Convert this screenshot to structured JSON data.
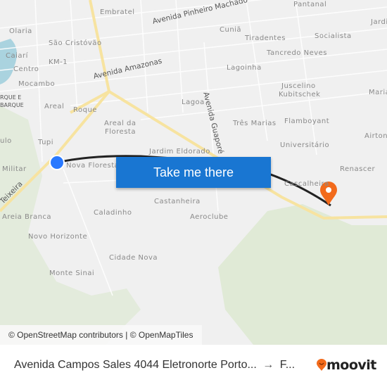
{
  "map": {
    "neighborhoods": [
      "Embratel",
      "Pantanal",
      "Olaria",
      "São Cristóvão",
      "Cuniã",
      "Tiradentes",
      "Socialista",
      "Jardi",
      "Caiarí",
      "KM-1",
      "Tancredo Neves",
      "Centro",
      "Lagoinha",
      "Mocambo",
      "Juscelino",
      "Kubitschek",
      "Maria",
      "RQUE E",
      "BARQUE",
      "Areal",
      "Roque",
      "Lagoa",
      "Areal da",
      "Floresta",
      "Três Marias",
      "Flamboyant",
      "Tupi",
      "Airton",
      "ulo",
      "Universitário",
      "Jardim Eldorado",
      "Militar",
      "Nova Floresta",
      "Cascalheira",
      "Renascer",
      "Castanheira",
      "Areia Branca",
      "Caladinho",
      "Aeroclube",
      "Novo Horizonte",
      "Cidade Nova",
      "Monte Sinai"
    ],
    "streets": [
      "Avenida Pinheiro Machado",
      "Avenida Amazonas",
      "Avenida Guaporé",
      "Teixeira"
    ],
    "origin_color": "#2979ff",
    "destination_color": "#f26a1b",
    "route_color": "#222222"
  },
  "cta": {
    "label": "Take me there",
    "color": "#1976d2"
  },
  "attribution": "© OpenStreetMap contributors | © OpenMapTiles",
  "footer": {
    "origin": "Avenida Campos Sales 4044 Eletronorte Porto...",
    "arrow": "→",
    "destination": "F...",
    "brand": "moovit",
    "brand_color": "#f26a1b"
  }
}
